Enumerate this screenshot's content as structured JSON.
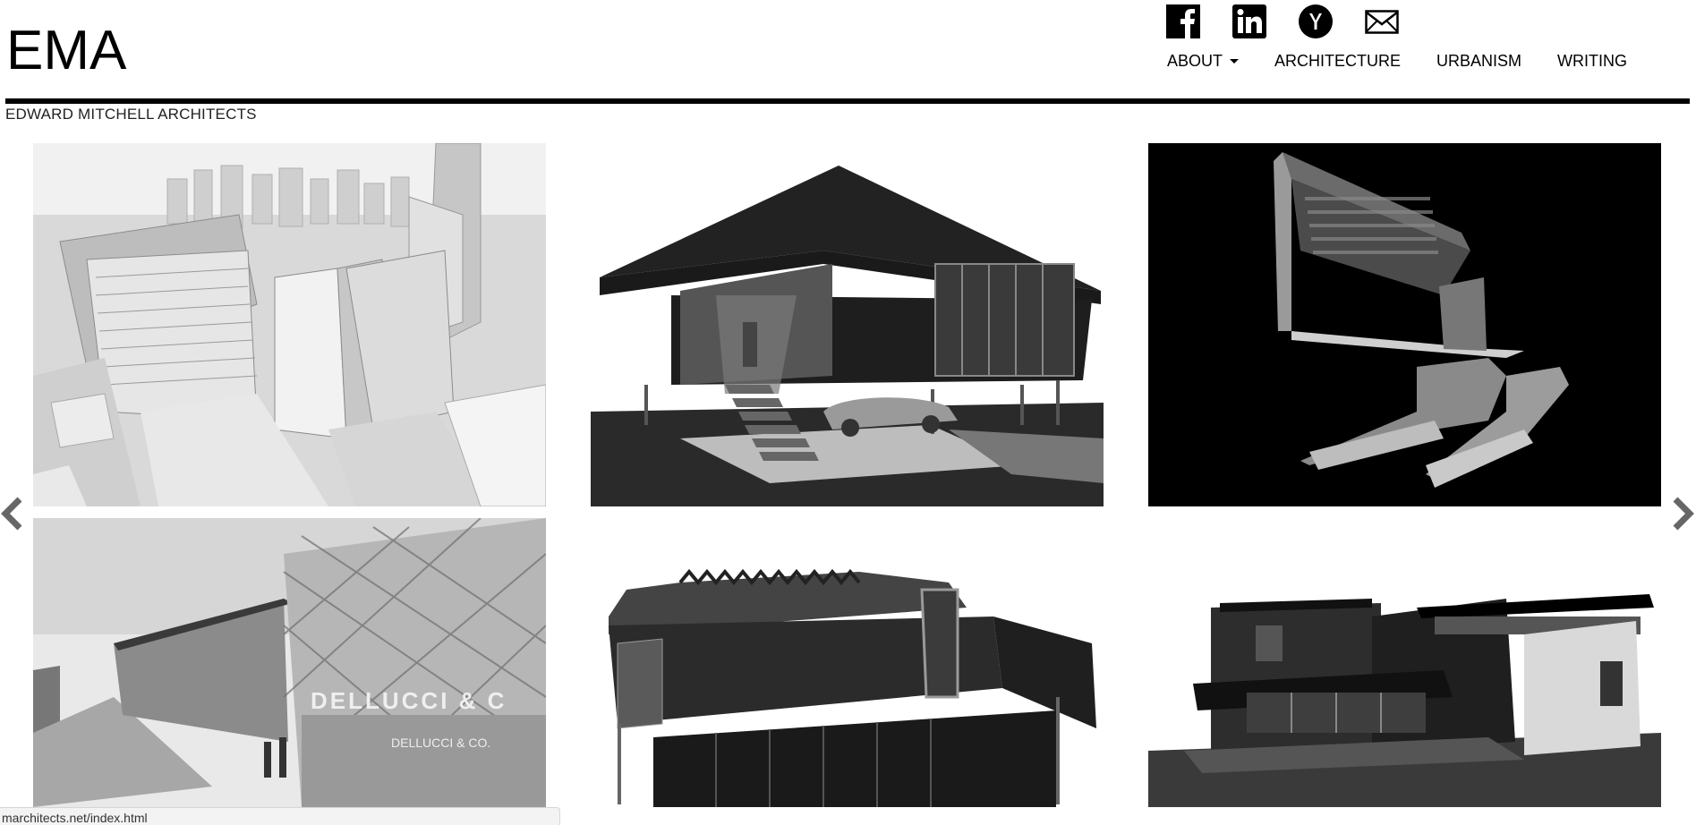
{
  "header": {
    "logo": "EMA",
    "subtitle": "EDWARD MITCHELL ARCHITECTS"
  },
  "social": [
    {
      "icon": "facebook-icon"
    },
    {
      "icon": "linkedin-icon"
    },
    {
      "icon": "hacker-news-icon"
    },
    {
      "icon": "mail-icon"
    }
  ],
  "nav": {
    "about": "ABOUT",
    "architecture": "ARCHITECTURE",
    "urbanism": "URBANISM",
    "writing": "WRITING"
  },
  "gallery": {
    "tiles": [
      {
        "caption": ""
      },
      {
        "caption": ""
      },
      {
        "caption": ""
      },
      {
        "sign_large": "DELLUCCI & C",
        "sign_small": "DELLUCCI & CO."
      },
      {
        "caption": ""
      },
      {
        "caption": ""
      }
    ]
  },
  "status": {
    "url": "marchitects.net/index.html"
  },
  "colors": {
    "text": "#000000",
    "rule": "#000000",
    "arrow": "#666666"
  }
}
